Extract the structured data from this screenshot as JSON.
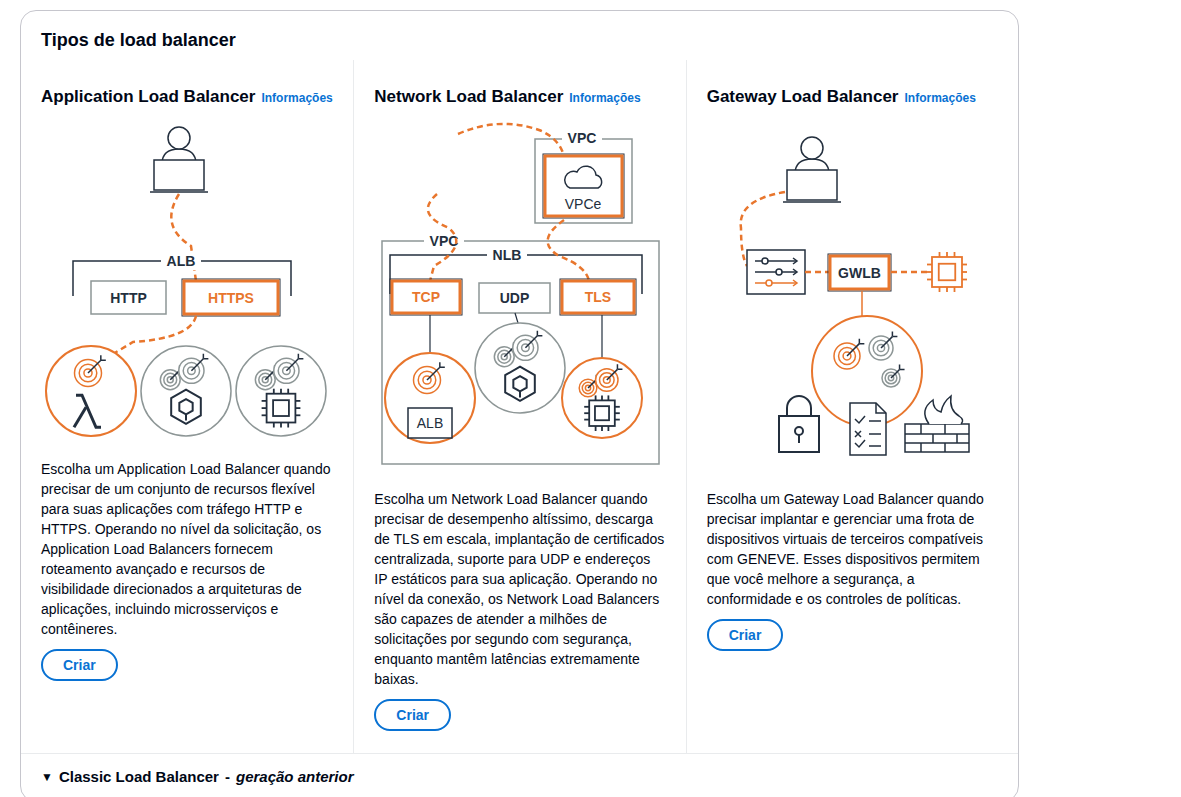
{
  "title": "Tipos de load balancer",
  "cards": [
    {
      "kind": "alb",
      "name": "Application Load Balancer",
      "info": "Informações",
      "diagram": {
        "group": "ALB",
        "listeners": [
          {
            "label": "HTTP",
            "selected": false
          },
          {
            "label": "HTTPS",
            "selected": true
          }
        ],
        "targets": [
          {
            "kind": "lambda",
            "selected": true
          },
          {
            "kind": "container",
            "selected": false
          },
          {
            "kind": "instance",
            "selected": false
          }
        ]
      },
      "description": "Escolha um Application Load Balancer quando precisar de um conjunto de recursos flexível para suas aplicações com tráfego HTTP e HTTPS. Operando no nível da solicitação, os Application Load Balancers fornecem roteamento avançado e recursos de visibilidade direcionados a arquiteturas de aplicações, incluindo microsserviços e contêineres.",
      "button": "Criar"
    },
    {
      "kind": "nlb",
      "name": "Network Load Balancer",
      "info": "Informações",
      "diagram": {
        "endpoint_vpc": "VPC",
        "endpoint": "VPCe",
        "vpc": "VPC",
        "group": "NLB",
        "listeners": [
          {
            "label": "TCP",
            "selected": true
          },
          {
            "label": "UDP",
            "selected": false
          },
          {
            "label": "TLS",
            "selected": true
          }
        ],
        "targets": [
          {
            "kind": "alb",
            "label": "ALB",
            "selected": true
          },
          {
            "kind": "container",
            "selected": false
          },
          {
            "kind": "instance",
            "selected": true
          }
        ]
      },
      "description": "Escolha um Network Load Balancer quando precisar de desempenho altíssimo, descarga de TLS em escala, implantação de certificados centralizada, suporte para UDP e endereços IP estáticos para sua aplicação. Operando no nível da conexão, os Network Load Balancers são capazes de atender a milhões de solicitações por segundo com segurança, enquanto mantêm latências extremamente baixas.",
      "button": "Criar"
    },
    {
      "kind": "gwlb",
      "name": "Gateway Load Balancer",
      "info": "Informações",
      "diagram": {
        "device": "GWLB"
      },
      "description": "Escolha um Gateway Load Balancer quando precisar implantar e gerenciar uma frota de dispositivos virtuais de terceiros compatíveis com GENEVE. Esses dispositivos permitem que você melhore a segurança, a conformidade e os controles de políticas.",
      "button": "Criar"
    }
  ],
  "classic": {
    "arrow": "▼",
    "label": "Classic Load Balancer",
    "separator": "-",
    "note": "geração anterior",
    "expanded": false
  }
}
